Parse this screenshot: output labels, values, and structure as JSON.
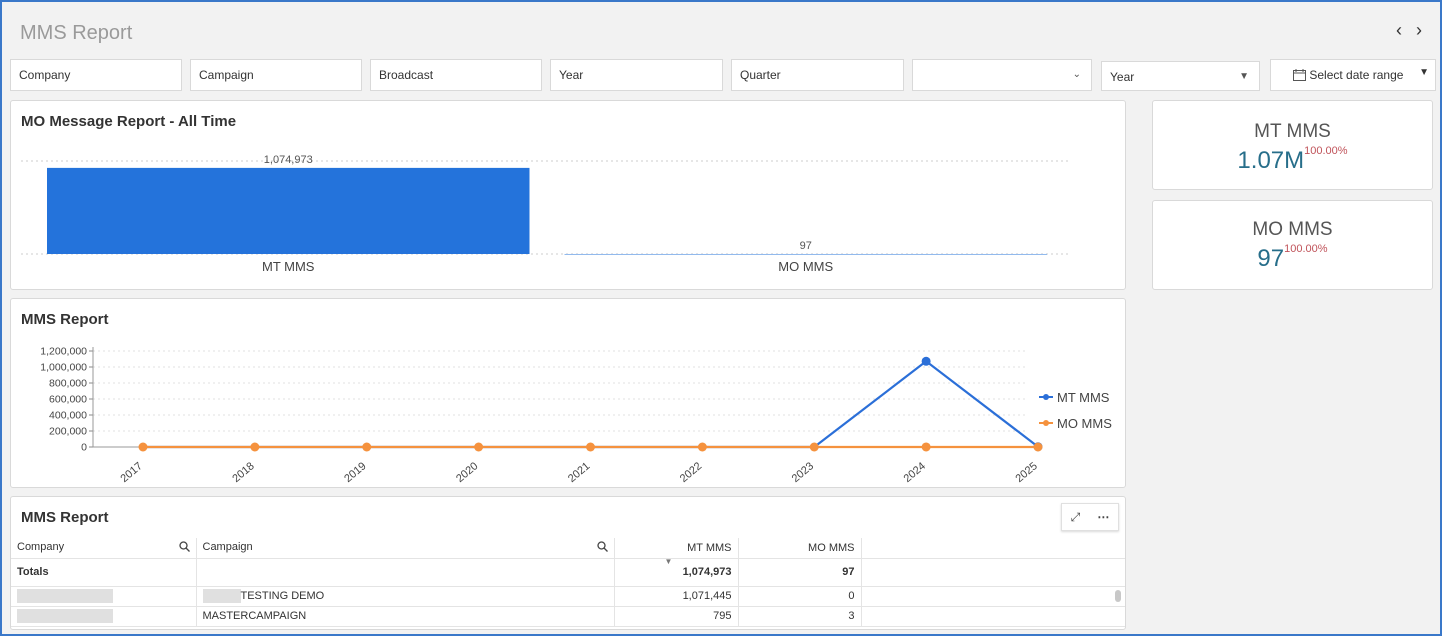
{
  "header": {
    "title": "MMS Report",
    "prev_icon": "chevron-left-icon",
    "next_icon": "chevron-right-icon",
    "prev": "‹",
    "next": "›"
  },
  "filters": {
    "company": "Company",
    "campaign": "Campaign",
    "broadcast": "Broadcast",
    "year": "Year",
    "quarter": "Quarter",
    "empty_select": "",
    "year_select": "Year",
    "date_range": "Select date range"
  },
  "bar_panel": {
    "title": "MO Message Report - All Time",
    "chart_data": {
      "type": "bar",
      "categories": [
        "MT MMS",
        "MO MMS"
      ],
      "values": [
        1074973,
        97
      ],
      "value_labels": [
        "1,074,973",
        "97"
      ],
      "color": "#2473db"
    }
  },
  "kpis": [
    {
      "title": "MT MMS",
      "value": "1.07M",
      "pct": "100.00%"
    },
    {
      "title": "MO MMS",
      "value": "97",
      "pct": "100.00%"
    }
  ],
  "line_panel": {
    "title": "MMS Report",
    "chart_data": {
      "type": "line",
      "x": [
        "2017",
        "2018",
        "2019",
        "2020",
        "2021",
        "2022",
        "2023",
        "2024",
        "2025"
      ],
      "ylim": [
        0,
        1200000
      ],
      "yticks": [
        "1,200,000",
        "1,000,000",
        "800,000",
        "600,000",
        "400,000",
        "200,000",
        "0"
      ],
      "series": [
        {
          "name": "MT MMS",
          "color": "#2b6fd8",
          "values": [
            0,
            0,
            0,
            0,
            0,
            0,
            0,
            1071445,
            3528
          ]
        },
        {
          "name": "MO MMS",
          "color": "#f5923e",
          "values": [
            0,
            0,
            0,
            0,
            0,
            0,
            0,
            94,
            3
          ]
        }
      ],
      "legend": "right"
    }
  },
  "table_panel": {
    "title": "MMS Report",
    "expand_icon": "expand-icon",
    "more_icon": "more-icon",
    "expand": "⤢",
    "more": "⋯",
    "headers": {
      "company": "Company",
      "campaign": "Campaign",
      "mt": "MT MMS",
      "mo": "MO MMS"
    },
    "totals": {
      "label": "Totals",
      "mt": "1,074,973",
      "mo": "97"
    },
    "rows": [
      {
        "campaign": "TESTING DEMO",
        "mt": "1,071,445",
        "mo": "0"
      },
      {
        "campaign": "MASTERCAMPAIGN",
        "mt": "795",
        "mo": "3"
      }
    ]
  }
}
